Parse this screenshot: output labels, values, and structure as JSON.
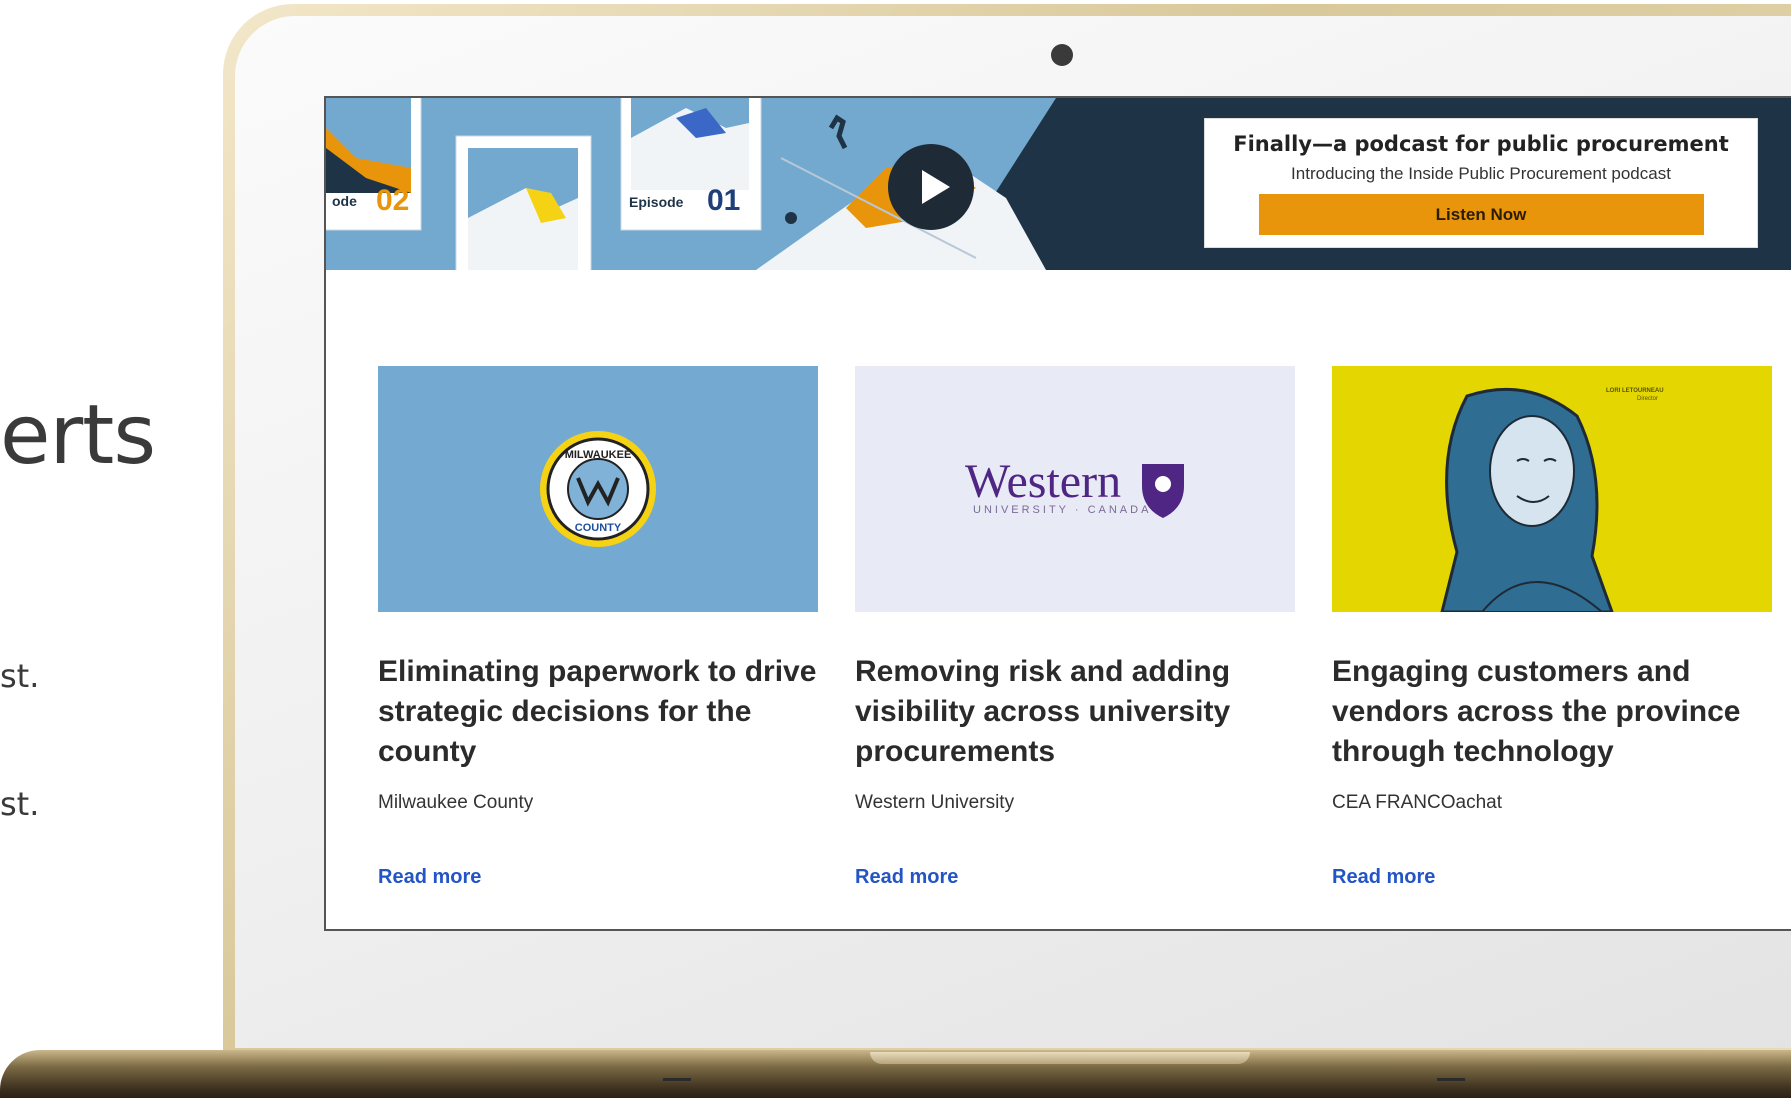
{
  "left_panel": {
    "heading_fragment": "erts",
    "line1_fragment": "st.",
    "line2_fragment": "st."
  },
  "banner": {
    "episodes": [
      {
        "prefix": "ode",
        "number": "02"
      },
      {
        "prefix": "Episode",
        "number": "01"
      }
    ],
    "promo_title": "Finally—a podcast for public procurement",
    "promo_subtitle": "Introducing the Inside Public Procurement podcast",
    "cta_label": "Listen Now"
  },
  "cards": [
    {
      "title": "Eliminating paperwork to drive strategic decisions for the county",
      "org": "Milwaukee County",
      "link_label": "Read more",
      "image": {
        "seal_top_text": "MILWAUKEE",
        "seal_bottom_text": "COUNTY"
      }
    },
    {
      "title": "Removing risk and adding visibility across university procurements",
      "org": "Western University",
      "link_label": "Read more",
      "image": {
        "logo_word": "Western",
        "logo_sub": "UNIVERSITY · CANADA"
      }
    },
    {
      "title": "Engaging customers and vendors across the province through technology",
      "org": "CEA FRANCOachat",
      "link_label": "Read more",
      "image": {
        "caption_name": "LORI LETOURNEAU",
        "caption_role": "Director"
      }
    }
  ],
  "colors": {
    "banner_blue": "#74a9cf",
    "banner_navy": "#1e3346",
    "accent_orange": "#e8950b",
    "link_blue": "#2355c4",
    "card1_bg": "#74a9d2",
    "card2_bg": "#e8ebf5",
    "card3_bg": "#e4d600",
    "western_purple": "#4f2683"
  },
  "icons": [
    "play-icon",
    "camera-icon"
  ]
}
